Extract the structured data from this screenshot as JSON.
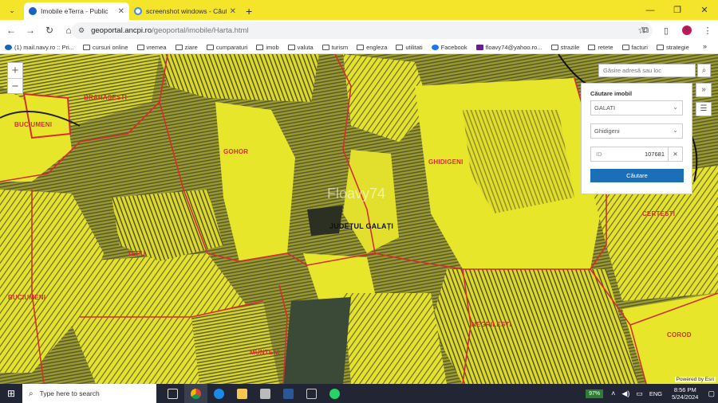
{
  "browser": {
    "tabs": [
      {
        "title": "Imobile eTerra - Public",
        "active": true,
        "favicon_color": "#1565c0"
      },
      {
        "title": "screenshot windows - Căutare",
        "active": false,
        "favicon_color": "#4285f4"
      }
    ],
    "new_tab_symbol": "+",
    "url_host": "geoportal.ancpi.ro",
    "url_path": "/geoportal/imobile/Harta.html",
    "bookmarks": [
      {
        "label": "(1) mail.navy.ro :: Pri...",
        "icon": "mail-icon"
      },
      {
        "label": "cursuri online",
        "icon": "folder-icon"
      },
      {
        "label": "vremea",
        "icon": "folder-icon"
      },
      {
        "label": "ziare",
        "icon": "folder-icon"
      },
      {
        "label": "cumparaturi",
        "icon": "folder-icon"
      },
      {
        "label": "imob",
        "icon": "folder-icon"
      },
      {
        "label": "valuta",
        "icon": "folder-icon"
      },
      {
        "label": "turism",
        "icon": "folder-icon"
      },
      {
        "label": "engleza",
        "icon": "folder-icon"
      },
      {
        "label": "utilitati",
        "icon": "folder-icon"
      },
      {
        "label": "Facebook",
        "icon": "facebook-icon"
      },
      {
        "label": "floavy74@yahoo.ro...",
        "icon": "yahoo-icon"
      },
      {
        "label": "strazile",
        "icon": "folder-icon"
      },
      {
        "label": "retete",
        "icon": "folder-icon"
      },
      {
        "label": "facturi",
        "icon": "folder-icon"
      },
      {
        "label": "strategie",
        "icon": "folder-icon"
      }
    ],
    "profile_initial": "K"
  },
  "map": {
    "search_placeholder": "Găsire adresă sau loc",
    "watermark": "Floavy74",
    "powered_by": "Powered by Esri",
    "territories": [
      {
        "name": "BRAHASESTI"
      },
      {
        "name": "BUCIUMENI"
      },
      {
        "name": "GOHOR"
      },
      {
        "name": "GHIDIGENI"
      },
      {
        "name": "JUDEȚUL GALAȚI",
        "kind": "county"
      },
      {
        "name": "TEPU"
      },
      {
        "name": "BUCIUMENI"
      },
      {
        "name": "NEGRILESTI"
      },
      {
        "name": "MUNTENI"
      },
      {
        "name": "COROD"
      },
      {
        "name": "CERTESTI"
      }
    ],
    "colors": {
      "parcels": "#e8e62a",
      "boundary": "#d32f2f",
      "imagery": "#4a4a2a"
    }
  },
  "panel": {
    "title": "Căutare imobil",
    "county_value": "GALATI",
    "uat_value": "Ghidigeni",
    "id_prefix": "ID",
    "id_value": "107681",
    "search_button": "Căutare"
  },
  "taskbar": {
    "search_placeholder": "Type here to search",
    "battery": "97%",
    "language": "ENG",
    "time": "8:56 PM",
    "date": "5/24/2024"
  }
}
